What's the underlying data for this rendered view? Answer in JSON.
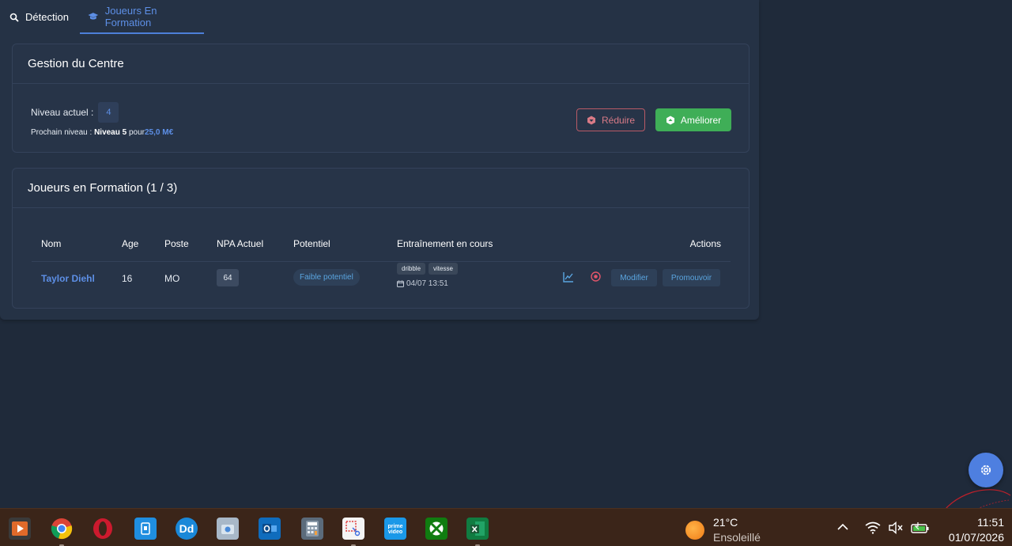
{
  "tabs": [
    {
      "label": "Détection",
      "active": false,
      "icon": "search-icon"
    },
    {
      "label": "Joueurs En Formation",
      "active": true,
      "icon": "graduation-cap-icon"
    }
  ],
  "gestion": {
    "title": "Gestion du Centre",
    "niveau_label": "Niveau actuel :",
    "niveau_value": "4",
    "prochain_prefix": "Prochain niveau :",
    "prochain_level": "Niveau 5",
    "prochain_mid": "pour",
    "prochain_cost": "25,0 M€",
    "reduire_label": "Réduire",
    "ameliorer_label": "Améliorer"
  },
  "joueurs": {
    "title": "Joueurs en Formation (1 / 3)",
    "columns": [
      "Nom",
      "Age",
      "Poste",
      "NPA Actuel",
      "Potentiel",
      "Entraînement en cours",
      "Actions"
    ],
    "rows": [
      {
        "nom": "Taylor Diehl",
        "age": "16",
        "poste": "MO",
        "npa": "64",
        "potentiel": "Faible potentiel",
        "tags": [
          "dribble",
          "vitesse"
        ],
        "date": "04/07 13:51",
        "modifier_label": "Modifier",
        "promouvoir_label": "Promouvoir"
      }
    ]
  },
  "taskbar": {
    "weather_temp": "21°C",
    "weather_desc": "Ensoleillé",
    "time": "11:51",
    "date": "01/07/2026"
  },
  "colors": {
    "accent": "#5d8fe6",
    "success": "#3fae57",
    "danger": "#d87a86",
    "background": "#1f2a3a"
  }
}
